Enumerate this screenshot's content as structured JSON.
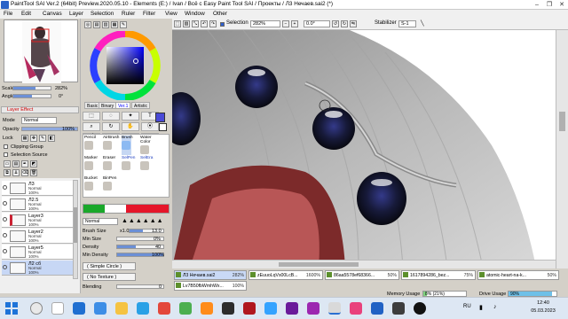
{
  "window": {
    "title": "PaintTool SAI Ver.2 (64bit) Preview.2020.05.10 - Elements (E:) / Ivan / Всё с Easy Paint Tool SAI / Проекты / Л3 Нечаев.sai2 (*)",
    "minimize": "–",
    "maximize": "❐",
    "close": "✕"
  },
  "menu": {
    "file": "File",
    "edit": "Edit",
    "canvas": "Canvas",
    "layer": "Layer",
    "selection": "Selection",
    "ruler": "Ruler",
    "filter": "Filter",
    "view": "View",
    "window": "Window",
    "other": "Other"
  },
  "navigator": {
    "scale_label": "Scale",
    "scale_value": "282%",
    "angle_label": "Angle",
    "angle_value": "0°"
  },
  "layer_panel": {
    "header": "Layer Effect",
    "mode_label": "Mode",
    "mode_value": "Normal",
    "opacity_label": "Opacity",
    "opacity_value": "100%",
    "lock_label": "Lock",
    "clipping_group": "Clipping Group",
    "selection_source": "Selection Source",
    "layers": [
      {
        "name": "Л3",
        "sub": "Normal\n100%"
      },
      {
        "name": "Л2.5",
        "sub": "Normal\n100%"
      },
      {
        "name": "Layer3",
        "sub": "Normal\n100%"
      },
      {
        "name": "Layer2",
        "sub": "Normal\n100%"
      },
      {
        "name": "Layer5",
        "sub": "Normal\n100%"
      },
      {
        "name": "Л2 сб",
        "sub": "Normal\n100%"
      }
    ]
  },
  "color_panel": {
    "tabs": [
      "Basic",
      "Binary",
      "Ver.1",
      "Artistic"
    ],
    "active_tab": "Ver.1",
    "primary_color": "#4a4ad6",
    "accent": "#e5162a"
  },
  "tools": {
    "brushes": [
      {
        "label": "Pencil"
      },
      {
        "label": "AirBrush"
      },
      {
        "label": "Brush"
      },
      {
        "label": "Water Color"
      },
      {
        "label": "Marker"
      },
      {
        "label": "Eraser"
      },
      {
        "label": "SelPen"
      },
      {
        "label": "SelEra"
      },
      {
        "label": "Bucket"
      },
      {
        "label": "BinPen"
      }
    ],
    "blend_mode": "Normal",
    "brush_size_label": "Brush Size",
    "brush_size_mult": "x1.0",
    "brush_size_value": "13.0",
    "min_size_label": "Min Size",
    "min_size_value": "0%",
    "density_label": "Density",
    "density_value": "40",
    "min_density_label": "Min Density",
    "min_density_value": "100%",
    "shape_label": "( Simple Circle )",
    "texture_label": "( No Texture )",
    "blending_label": "Blending",
    "blending_value": "0"
  },
  "canvas_toolbar": {
    "selection_label": "Selection",
    "zoom_value": "282%",
    "angle_value": "0.0°",
    "stabilizer_label": "Stabilizer",
    "stabilizer_value": "S-1"
  },
  "file_tabs": [
    {
      "name": "Л3 Нечаев.sai2",
      "pct": "282%"
    },
    {
      "name": "zEuuoLqVs00LcB...",
      "pct": "1600%"
    },
    {
      "name": "86aa5578ef68366...",
      "pct": "50%"
    },
    {
      "name": "1617894286_bez...",
      "pct": "75%"
    },
    {
      "name": "atomic-heart-na-k...",
      "pct": "50%"
    },
    {
      "name": "Lv7B50fbWmhWx...",
      "pct": "100%"
    }
  ],
  "status": {
    "memory_label": "Memory Usage",
    "memory_value": "8% (21%)",
    "memory_fraction": 0.08,
    "drive_label": "Drive Usage",
    "drive_value": "90%",
    "drive_fraction": 0.9
  },
  "taskbar": {
    "lang": "RU",
    "time": "12:40",
    "date": "05.03.2023"
  }
}
